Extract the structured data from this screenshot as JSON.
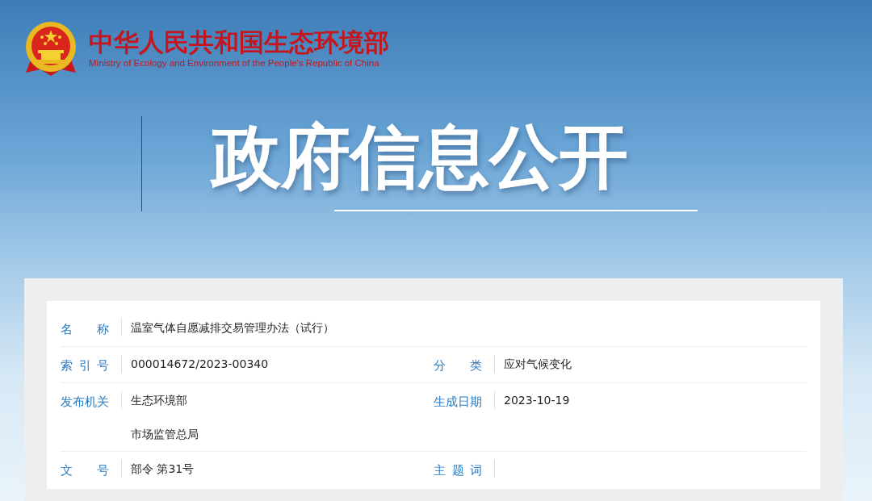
{
  "header": {
    "title_zh": "中华人民共和国生态环境部",
    "title_en": "Ministry of Ecology and Environment of the People's Republic of China"
  },
  "banner": {
    "title": "政府信息公开"
  },
  "info_table": {
    "rows": [
      {
        "fields": [
          {
            "label": "名称",
            "values": [
              "温室气体自愿减排交易管理办法（试行）"
            ]
          }
        ]
      },
      {
        "fields": [
          {
            "label": "索引号",
            "values": [
              "000014672/2023-00340"
            ]
          },
          {
            "label": "分类",
            "values": [
              "应对气候变化"
            ]
          }
        ]
      },
      {
        "fields": [
          {
            "label": "发布机关",
            "values": [
              "生态环境部",
              "市场监管总局"
            ]
          },
          {
            "label": "生成日期",
            "values": [
              "2023-10-19"
            ]
          }
        ]
      },
      {
        "fields": [
          {
            "label": "文号",
            "values": [
              "部令 第31号"
            ]
          },
          {
            "label": "主题词"
          }
        ]
      }
    ]
  }
}
